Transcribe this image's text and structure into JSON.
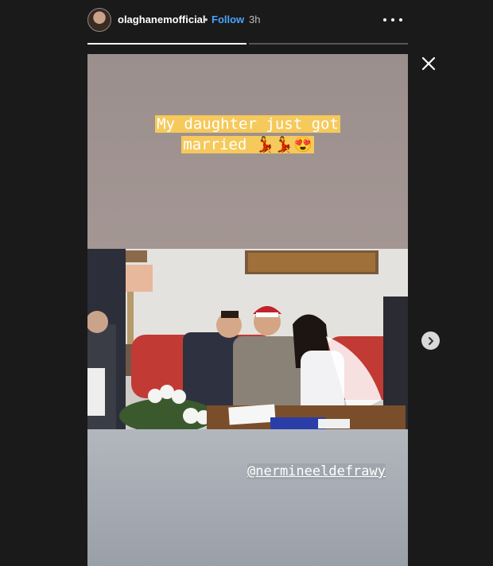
{
  "header": {
    "username": "olaghanemofficial",
    "separator": "•",
    "follow_label": "Follow",
    "time": "3h"
  },
  "progress": {
    "segments": 2,
    "active_index": 0,
    "active_fill": 1.0
  },
  "story": {
    "caption_line1": "My daughter just got",
    "caption_line2": "married 💃💃😍",
    "mention": "@nermineeldefrawy"
  },
  "icons": {
    "close": "close-icon",
    "more": "more-options-icon",
    "next": "chevron-right-icon"
  },
  "colors": {
    "follow": "#4aa3ff",
    "highlight": "#f5c95b",
    "background": "#1a1a1a"
  }
}
